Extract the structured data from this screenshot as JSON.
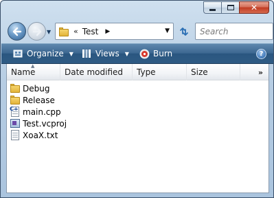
{
  "window": {
    "caption_buttons": {
      "minimize": "minimize",
      "maximize": "maximize",
      "close": "✕"
    }
  },
  "navigation": {
    "back_icon": "back-arrow-icon",
    "forward_icon": "forward-arrow-icon",
    "address": {
      "overflow_chevron": "«",
      "path_segment": "Test",
      "segment_arrow": "▶",
      "dropdown_arrow": "▼"
    },
    "search_placeholder": "Search"
  },
  "command_bar": {
    "organize_label": "Organize",
    "views_label": "Views",
    "burn_label": "Burn",
    "help_label": "?",
    "dropdown_glyph": "▼"
  },
  "columns": {
    "name": "Name",
    "date_modified": "Date modified",
    "type": "Type",
    "size": "Size",
    "more": "»"
  },
  "files": [
    {
      "name": "Debug",
      "icon": "folder-icon"
    },
    {
      "name": "Release",
      "icon": "folder-icon"
    },
    {
      "name": "main.cpp",
      "icon": "cpp-file-icon"
    },
    {
      "name": "Test.vcproj",
      "icon": "vcproj-file-icon"
    },
    {
      "name": "XoaX.txt",
      "icon": "text-file-icon"
    }
  ],
  "colors": {
    "command_bar": "#3c6791",
    "close_button": "#c13b22",
    "folder": "#e2b43a"
  }
}
